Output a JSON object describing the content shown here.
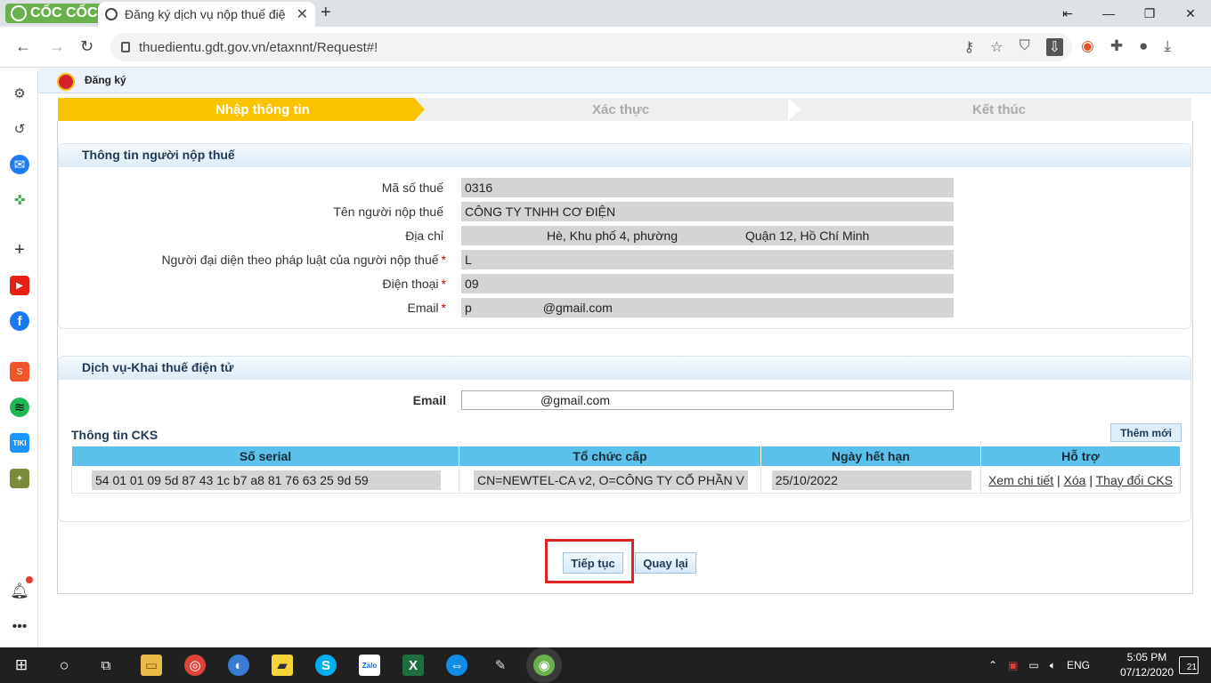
{
  "browser": {
    "brand": "CỐC CỐC",
    "tab_title": "Đăng ký dịch vụ nộp thuế điệ",
    "url": "thuedientu.gdt.gov.vn/etaxnnt/Request#!",
    "accent": "#6ab04c"
  },
  "page": {
    "header_title": "Đăng ký",
    "steps": [
      "Nhập thông tin",
      "Xác thực",
      "Kết thúc"
    ],
    "active_step_color": "#f9c300"
  },
  "taxpayer": {
    "section_title": "Thông tin người nộp thuế",
    "fields": [
      {
        "label": "Mã số thuế",
        "value": "0316",
        "required": ""
      },
      {
        "label": "Tên người nộp thuế",
        "value": "CÔNG TY TNHH CƠ ĐIỆN",
        "required": ""
      },
      {
        "label": "Địa chỉ",
        "value": "Hè, Khu phố 4, phường",
        "value2": "Quận 12, Hồ Chí Minh",
        "required": ""
      },
      {
        "label": "Người đại diện theo pháp luật của người nộp thuế",
        "value": "L",
        "required": "*"
      },
      {
        "label": "Điện thoại",
        "value": "09",
        "required": "*"
      },
      {
        "label": "Email",
        "value": "p",
        "value2": "@gmail.com",
        "required": "*"
      }
    ]
  },
  "service": {
    "section_title": "Dịch vụ-Khai thuế điện tử",
    "email_label": "Email",
    "email_value_suffix": "@gmail.com",
    "cks_title": "Thông tin CKS",
    "add_button": "Thêm mới",
    "columns": [
      "Số serial",
      "Tổ chức cấp",
      "Ngày hết hạn",
      "Hỗ trợ"
    ],
    "rows": [
      {
        "serial": "54 01 01 09 5d 87 43 1c b7 a8 81 76 63 25 9d 59",
        "issuer": "CN=NEWTEL-CA v2, O=CÔNG TY CỔ PHẦN V",
        "expiry": "25/10/2022",
        "actions": [
          "Xem chi tiết",
          "Xóa",
          "Thay đổi CKS"
        ]
      }
    ]
  },
  "buttons": {
    "continue": "Tiếp tục",
    "back": "Quay lại"
  },
  "taskbar": {
    "language": "ENG",
    "time": "5:05 PM",
    "date": "07/12/2020",
    "notification_count": "21"
  },
  "icons": [
    "settings-icon",
    "history-icon",
    "messenger-icon",
    "game-icon",
    "add-icon",
    "youtube-icon",
    "facebook-icon",
    "shopee-icon",
    "spotify-icon",
    "tiki-icon",
    "game-thumbnail-icon",
    "bell-icon",
    "more-icon"
  ]
}
